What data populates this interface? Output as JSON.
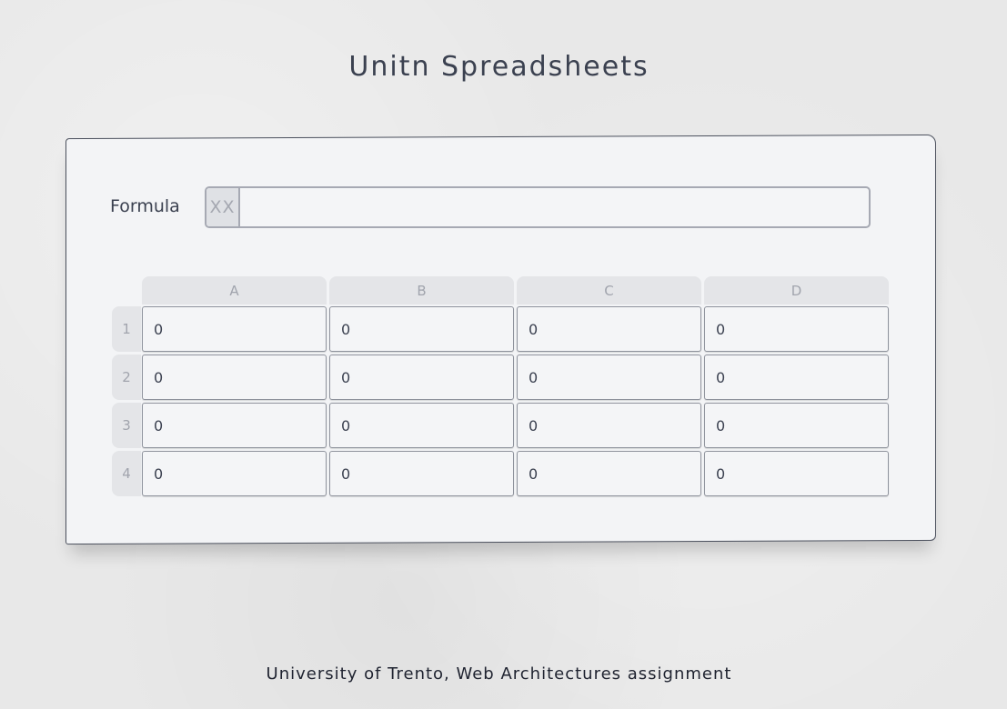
{
  "title": "Unitn Spreadsheets",
  "formula": {
    "label": "Formula",
    "cell_ref": "XX",
    "value": ""
  },
  "sheet": {
    "columns": [
      "A",
      "B",
      "C",
      "D"
    ],
    "rows": [
      {
        "label": "1",
        "cells": [
          "0",
          "0",
          "0",
          "0"
        ]
      },
      {
        "label": "2",
        "cells": [
          "0",
          "0",
          "0",
          "0"
        ]
      },
      {
        "label": "3",
        "cells": [
          "0",
          "0",
          "0",
          "0"
        ]
      },
      {
        "label": "4",
        "cells": [
          "0",
          "0",
          "0",
          "0"
        ]
      }
    ]
  },
  "footer": "University of Trento, Web Architectures assignment"
}
